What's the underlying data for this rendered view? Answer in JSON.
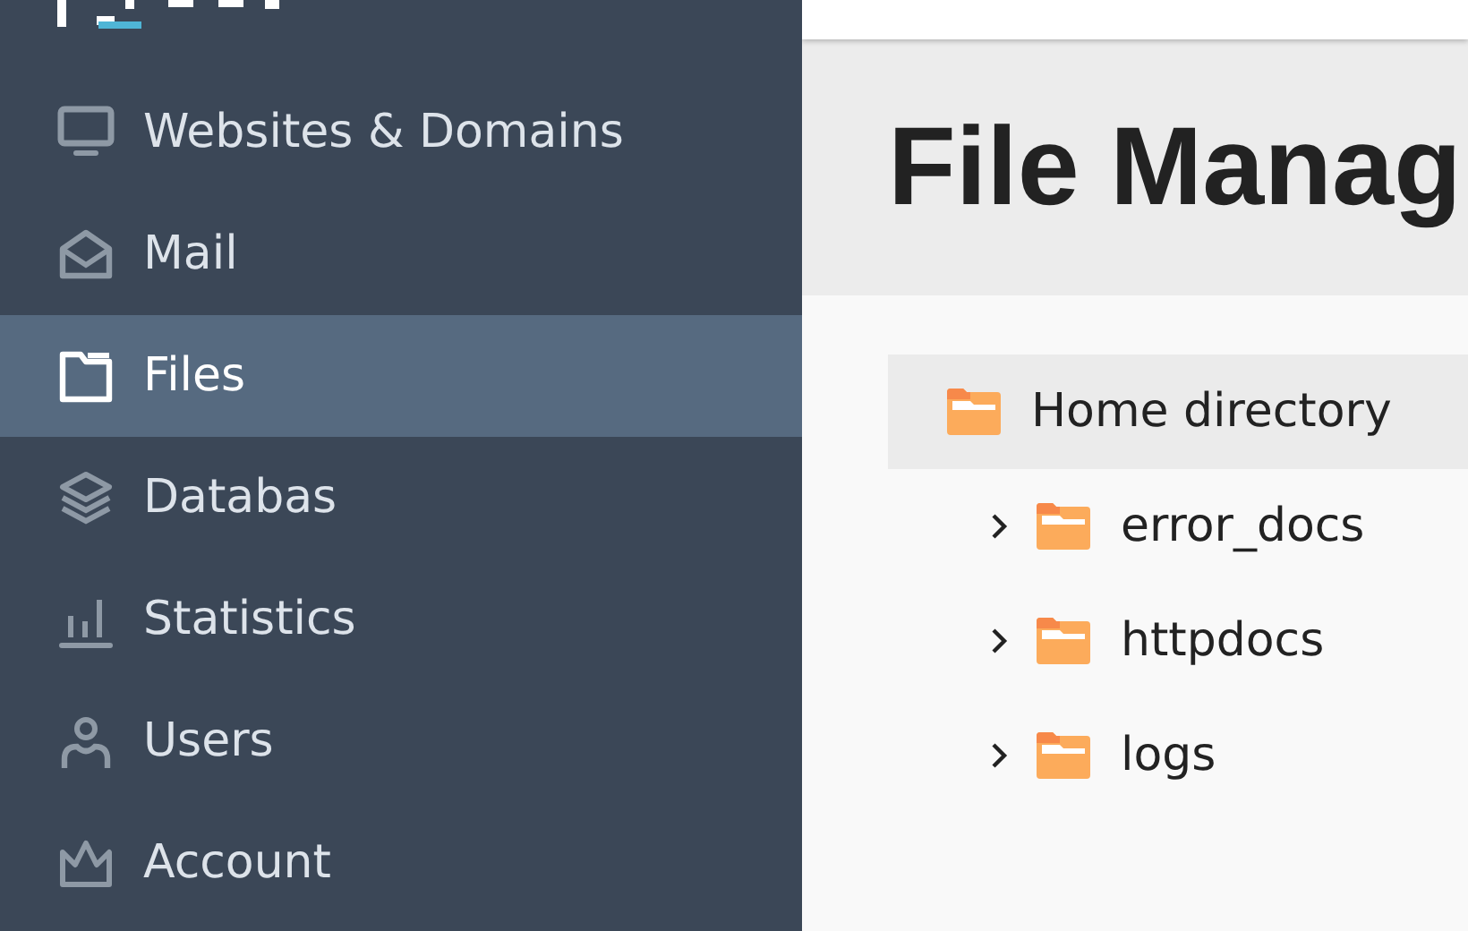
{
  "sidebar": {
    "items": [
      {
        "kind": "monitor",
        "label": "Websites & Domains",
        "selected": false
      },
      {
        "kind": "mail",
        "label": "Mail",
        "selected": false
      },
      {
        "kind": "files",
        "label": "Files",
        "selected": true
      },
      {
        "kind": "layers",
        "label": "Databas",
        "selected": false
      },
      {
        "kind": "chart",
        "label": "Statistics",
        "selected": false
      },
      {
        "kind": "user",
        "label": "Users",
        "selected": false
      },
      {
        "kind": "crown",
        "label": "Account",
        "selected": false
      }
    ]
  },
  "page_title": "File Manag",
  "tree": {
    "label": "Home directory",
    "selected": true,
    "children": [
      {
        "label": "error_docs",
        "expanded": false,
        "selected": false
      },
      {
        "label": "httpdocs",
        "expanded": false,
        "selected": false
      },
      {
        "label": "logs",
        "expanded": false,
        "selected": false
      }
    ]
  }
}
